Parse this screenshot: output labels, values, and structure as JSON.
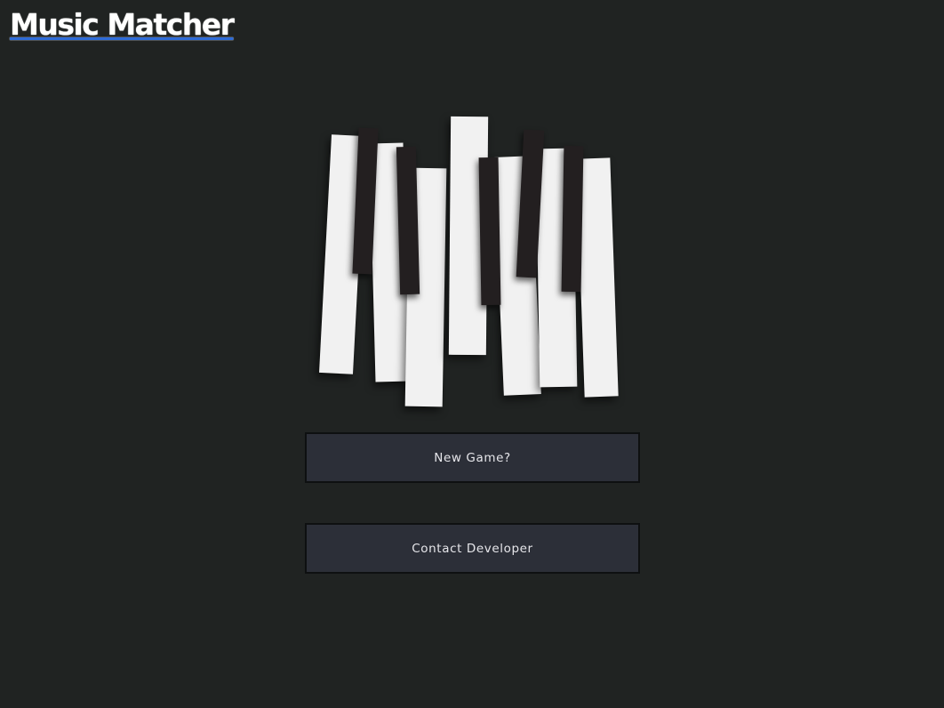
{
  "app": {
    "title": "Music Matcher"
  },
  "hero": {
    "image": "piano-keys-illustration"
  },
  "menu": {
    "new_game_label": "New Game?",
    "contact_label": "Contact Developer"
  },
  "colors": {
    "background": "#202322",
    "button_background": "#2c2f38",
    "button_border": "#0e1011",
    "white_key": "#f1f1f1",
    "black_key": "#231f20",
    "logo_underline": "#2d6bd8"
  }
}
